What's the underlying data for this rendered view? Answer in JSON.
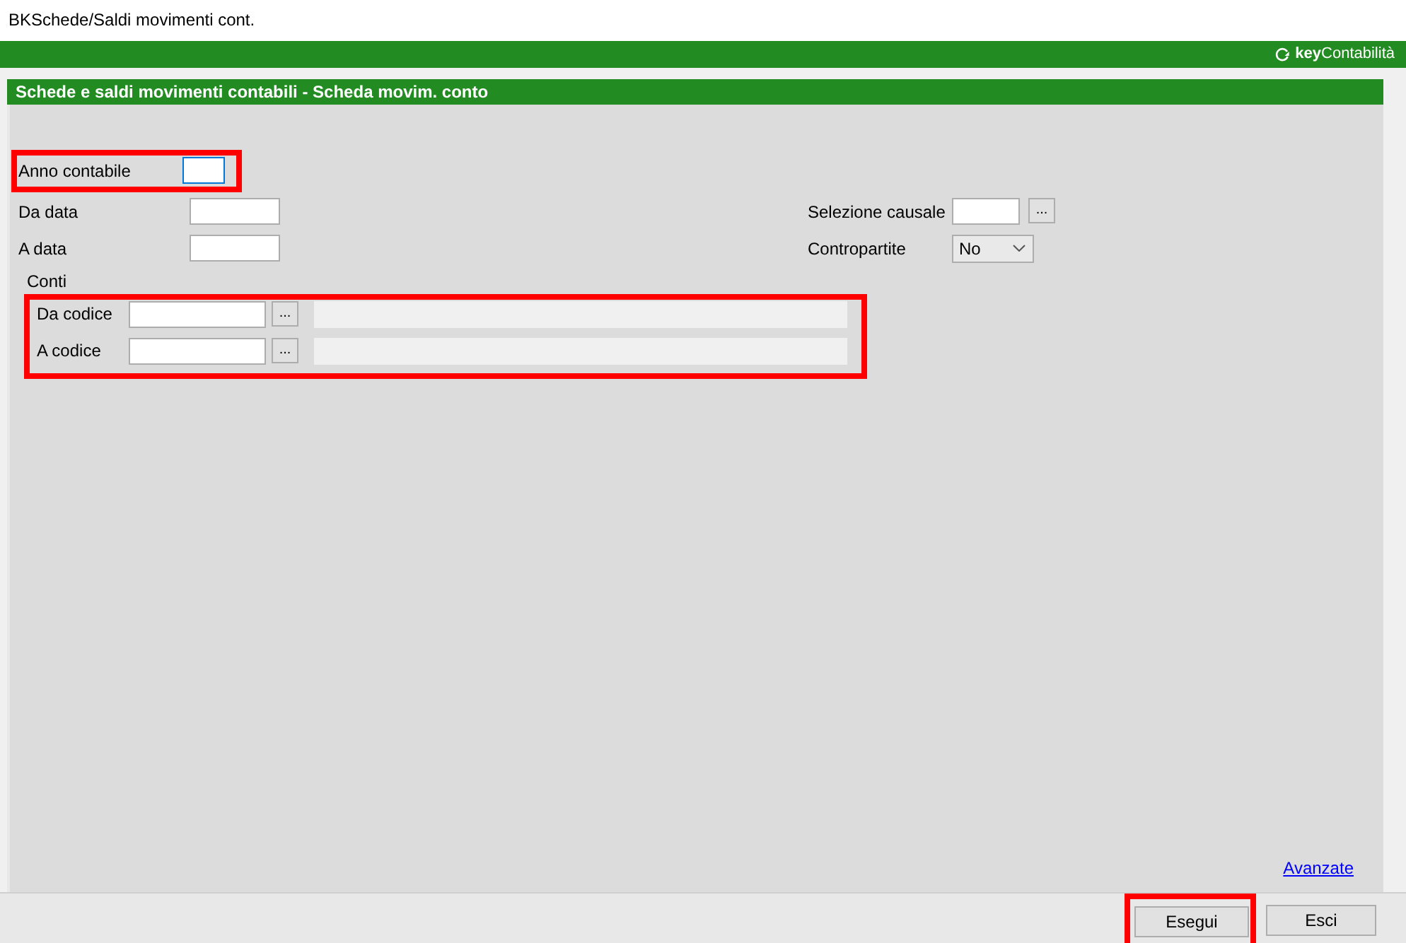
{
  "window": {
    "title": "BKSchede/Saldi movimenti cont."
  },
  "brand": {
    "text": "**key**Contabilità"
  },
  "panel": {
    "title": "Schede e saldi movimenti contabili - Scheda movim. conto"
  },
  "anno": {
    "label": "Anno contabile",
    "focused": true
  },
  "left_fields": [
    {
      "label": "Da data"
    },
    {
      "label": "A data"
    }
  ],
  "right_fields": [
    {
      "label": "Selezione causale",
      "kind": "lookup",
      "button": "..."
    },
    {
      "label": "Contropartite",
      "kind": "select",
      "value": "No"
    }
  ],
  "conti": {
    "title": "Conti",
    "rows": [
      {
        "label": "Da codice",
        "button": "..."
      },
      {
        "label": "A codice",
        "button": "..."
      }
    ]
  },
  "link": "Avanzate",
  "buttons": [
    {
      "label": "Esegui",
      "highlighted": true
    },
    {
      "label": "Esci",
      "highlighted": false
    }
  ]
}
